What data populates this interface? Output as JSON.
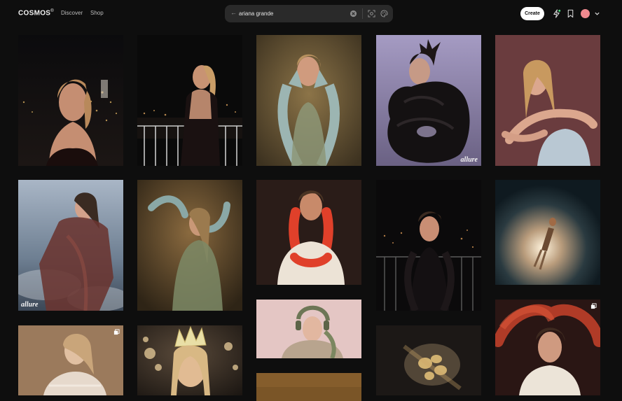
{
  "app": {
    "brand": "COSMOS"
  },
  "nav": {
    "discover": "Discover",
    "shop": "Shop"
  },
  "search": {
    "value": "ariana grande"
  },
  "header": {
    "create_label": "Create"
  },
  "icons": {
    "back": "back-arrow-icon",
    "clear": "clear-icon",
    "visual_search": "visual-search-icon",
    "color_palette": "palette-icon",
    "activity": "lightning-icon",
    "saved": "bookmark-icon",
    "account_menu": "chevron-down-icon"
  },
  "colors": {
    "background": "#0e0e0e",
    "create_button": "#ffffff",
    "avatar": "#f08a8f"
  },
  "grid": {
    "tiles": [
      {
        "id": "c1r1",
        "scene": "night-city portrait",
        "watermark": ""
      },
      {
        "id": "c2r1",
        "scene": "balcony night back view",
        "watermark": ""
      },
      {
        "id": "c3r1",
        "scene": "hands on face gold",
        "watermark": ""
      },
      {
        "id": "c4r1",
        "scene": "black ruffle lavender",
        "watermark": "allure"
      },
      {
        "id": "c5r1",
        "scene": "mauve backdrop eyes closed",
        "watermark": ""
      },
      {
        "id": "c1r2",
        "scene": "sheer dress sky",
        "watermark": "allure"
      },
      {
        "id": "c2r2",
        "scene": "arms raised gold",
        "watermark": ""
      },
      {
        "id": "c3r2",
        "scene": "red gloves",
        "watermark": ""
      },
      {
        "id": "c4r2",
        "scene": "balcony black gloves",
        "watermark": ""
      },
      {
        "id": "c5r2",
        "scene": "glowing figure",
        "watermark": ""
      },
      {
        "id": "c3r3",
        "scene": "headphones pink",
        "watermark": ""
      },
      {
        "id": "c5r3",
        "scene": "red blur hands",
        "watermark": ""
      },
      {
        "id": "c1r3",
        "scene": "gold portrait",
        "watermark": ""
      },
      {
        "id": "c2r3",
        "scene": "crown bokeh",
        "watermark": ""
      },
      {
        "id": "c4r3",
        "scene": "gold blur",
        "watermark": ""
      },
      {
        "id": "c3r4",
        "scene": "amber partial",
        "watermark": ""
      }
    ]
  }
}
